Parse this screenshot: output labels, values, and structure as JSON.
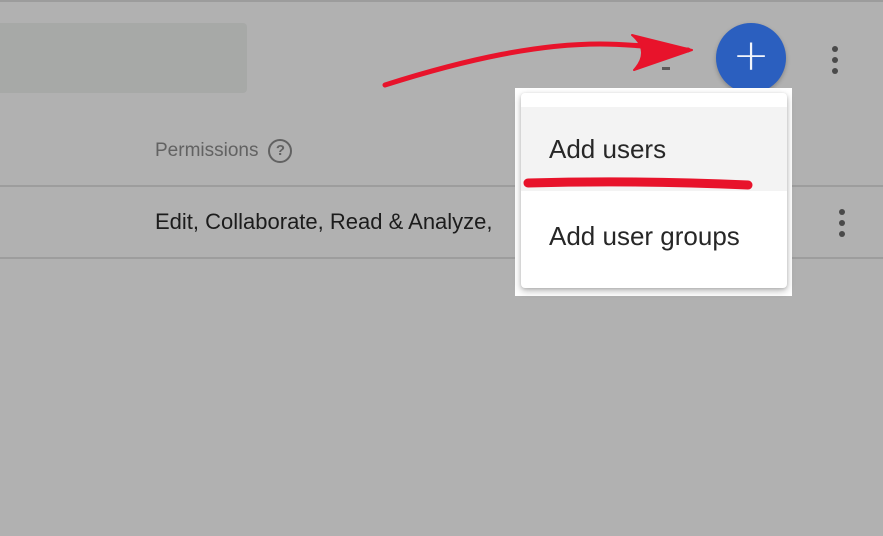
{
  "table": {
    "permissions_header": "Permissions",
    "help_symbol": "?",
    "row_permissions": "Edit, Collaborate, Read & Analyze,"
  },
  "toolbar": {
    "add_symbol": "+",
    "dash": "-"
  },
  "add_menu": {
    "items": [
      {
        "label": "Add users"
      },
      {
        "label": "Add user groups"
      }
    ]
  },
  "annotation": {
    "color": "#e8132b"
  },
  "colors": {
    "accent": "#2b5fbf",
    "background": "#b1b1b1"
  },
  "icons": [
    "help-icon",
    "plus-icon",
    "more-vert-icon"
  ]
}
